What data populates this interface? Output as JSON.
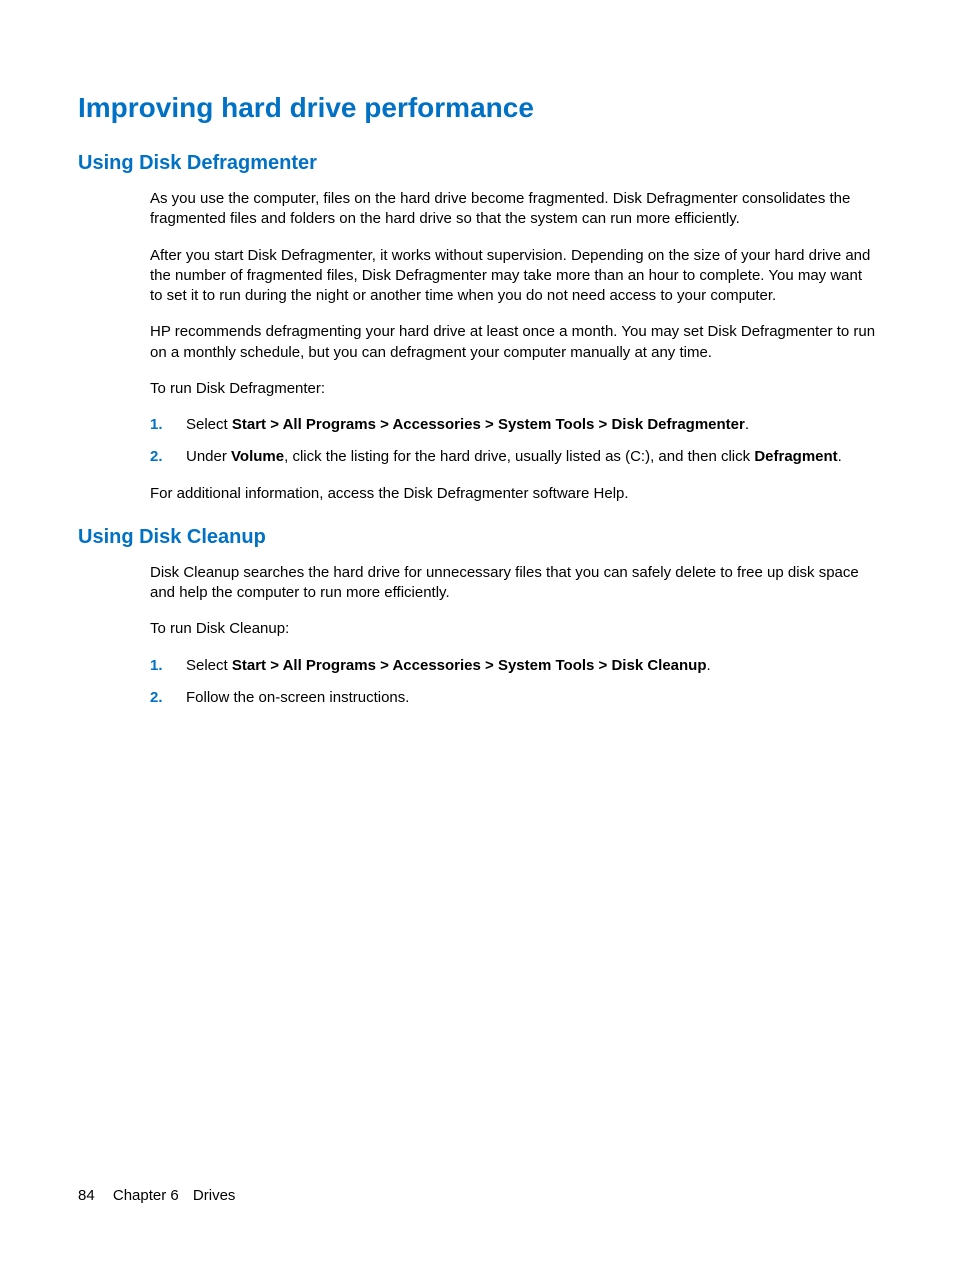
{
  "title": "Improving hard drive performance",
  "section1": {
    "heading": "Using Disk Defragmenter",
    "p1": "As you use the computer, files on the hard drive become fragmented. Disk Defragmenter consolidates the fragmented files and folders on the hard drive so that the system can run more efficiently.",
    "p2": "After you start Disk Defragmenter, it works without supervision. Depending on the size of your hard drive and the number of fragmented files, Disk Defragmenter may take more than an hour to complete. You may want to set it to run during the night or another time when you do not need access to your computer.",
    "p3": "HP recommends defragmenting your hard drive at least once a month. You may set Disk Defragmenter to run on a monthly schedule, but you can defragment your computer manually at any time.",
    "p4": "To run Disk Defragmenter:",
    "step1": {
      "num": "1.",
      "pre": "Select ",
      "bold": "Start > All Programs > Accessories > System Tools > Disk Defragmenter",
      "post": "."
    },
    "step2": {
      "num": "2.",
      "pre": "Under ",
      "bold1": "Volume",
      "mid": ", click the listing for the hard drive, usually listed as (C:), and then click ",
      "bold2": "Defragment",
      "post": "."
    },
    "p5": "For additional information, access the Disk Defragmenter software Help."
  },
  "section2": {
    "heading": "Using Disk Cleanup",
    "p1": "Disk Cleanup searches the hard drive for unnecessary files that you can safely delete to free up disk space and help the computer to run more efficiently.",
    "p2": "To run Disk Cleanup:",
    "step1": {
      "num": "1.",
      "pre": "Select ",
      "bold": "Start > All Programs > Accessories > System Tools > Disk Cleanup",
      "post": "."
    },
    "step2": {
      "num": "2.",
      "text": "Follow the on-screen instructions."
    }
  },
  "footer": {
    "page": "84",
    "chapter": "Chapter 6",
    "section": "Drives"
  }
}
